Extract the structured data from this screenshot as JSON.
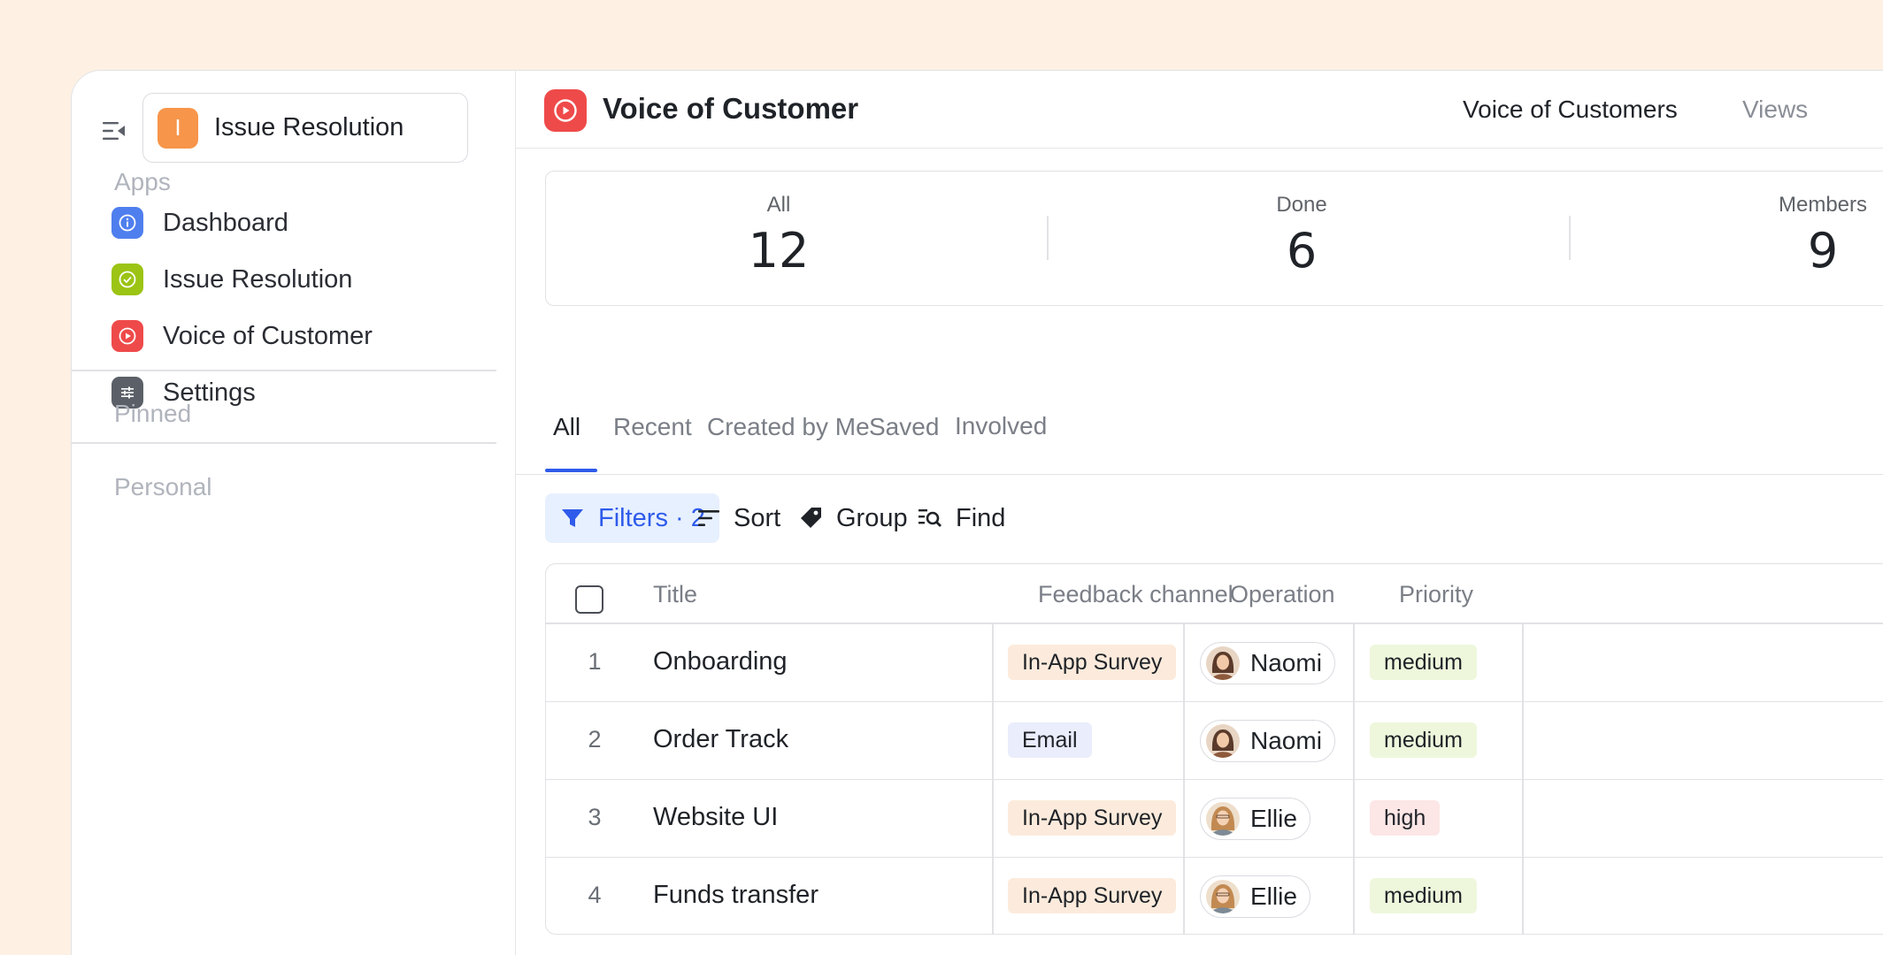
{
  "sidebar": {
    "workspace": {
      "badge": "I",
      "name": "Issue Resolution"
    },
    "apps_label": "Apps",
    "items": [
      {
        "label": "Dashboard",
        "icon": "info-icon",
        "color": "#4f7fee"
      },
      {
        "label": "Issue Resolution",
        "icon": "check-circle-icon",
        "color": "#9bc414"
      },
      {
        "label": "Voice of Customer",
        "icon": "play-circle-icon",
        "color": "#ef4a4a"
      },
      {
        "label": "Settings",
        "icon": "sliders-icon",
        "color": "#5b6068"
      }
    ],
    "pinned_label": "Pinned",
    "personal_label": "Personal"
  },
  "header": {
    "title": "Voice of Customer",
    "links": [
      {
        "label": "Voice of Customers"
      },
      {
        "label": "Views"
      }
    ]
  },
  "stats": [
    {
      "label": "All",
      "value": "12"
    },
    {
      "label": "Done",
      "value": "6"
    },
    {
      "label": "Members",
      "value": "9"
    }
  ],
  "tabs": [
    {
      "label": "All",
      "active": true
    },
    {
      "label": "Recent"
    },
    {
      "label": "Created by Me"
    },
    {
      "label": "Saved"
    },
    {
      "label": "Involved"
    }
  ],
  "toolbar": {
    "filters": "Filters · 2",
    "sort": "Sort",
    "group": "Group",
    "find": "Find"
  },
  "table": {
    "columns": [
      "Title",
      "Feedback channel",
      "Operation",
      "Priority"
    ],
    "rows": [
      {
        "num": "1",
        "title": "Onboarding",
        "channel": "In-App Survey",
        "operator": "Naomi",
        "priority": "medium"
      },
      {
        "num": "2",
        "title": "Order Track",
        "channel": "Email",
        "operator": "Naomi",
        "priority": "medium"
      },
      {
        "num": "3",
        "title": "Website UI",
        "channel": "In-App Survey",
        "operator": "Ellie",
        "priority": "high"
      },
      {
        "num": "4",
        "title": "Funds transfer",
        "channel": "In-App Survey",
        "operator": "Ellie",
        "priority": "medium"
      }
    ]
  },
  "colors": {
    "accent": "#2f5bea",
    "background": "#fef1e4",
    "workspace_badge": "#f7954a"
  }
}
